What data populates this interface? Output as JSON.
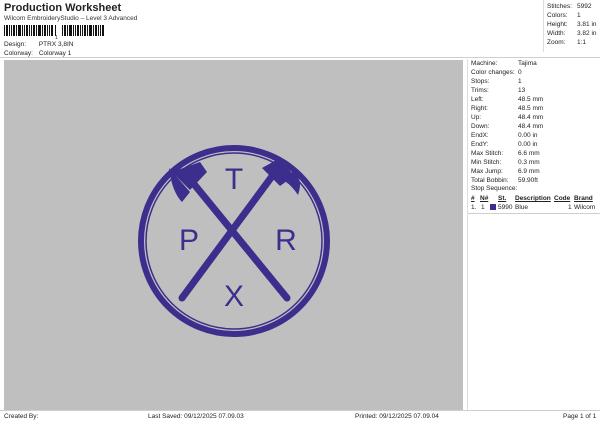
{
  "header": {
    "title": "Production Worksheet",
    "subtitle": "Wilcom EmbroideryStudio – Level 3 Advanced",
    "barcode_number": "1"
  },
  "design_info": {
    "design_label": "Design:",
    "design_value": "PTRX 3,8IN",
    "colorway_label": "Colorway:",
    "colorway_value": "Colorway 1"
  },
  "stats": {
    "stitches_label": "Stitches:",
    "stitches_value": "5992",
    "colors_label": "Colors:",
    "colors_value": "1",
    "height_label": "Height:",
    "height_value": "3.81 in",
    "width_label": "Width:",
    "width_value": "3.82 in",
    "zoom_label": "Zoom:",
    "zoom_value": "1:1"
  },
  "design": {
    "thread_color": "#3b2e8c",
    "letters": {
      "top": "T",
      "left": "P",
      "right": "R",
      "bottom": "X"
    }
  },
  "machine_info": {
    "machine_label": "Machine:",
    "machine_value": "Tajima",
    "color_changes_label": "Color changes:",
    "color_changes_value": "0",
    "stops_label": "Stops:",
    "stops_value": "1",
    "trims_label": "Trims:",
    "trims_value": "13",
    "left_label": "Left:",
    "left_value": "48.5 mm",
    "right_label": "Right:",
    "right_value": "48.5 mm",
    "up_label": "Up:",
    "up_value": "48.4 mm",
    "down_label": "Down:",
    "down_value": "48.4 mm",
    "endx_label": "EndX:",
    "endx_value": "0.00 in",
    "endy_label": "EndY:",
    "endy_value": "0.00 in",
    "max_stitch_label": "Max Stitch:",
    "max_stitch_value": "6.6 mm",
    "min_stitch_label": "Min Stitch:",
    "min_stitch_value": "0.3 mm",
    "max_jump_label": "Max Jump:",
    "max_jump_value": "6.9 mm",
    "total_bobbin_label": "Total Bobbin:",
    "total_bobbin_value": "59.90ft"
  },
  "stop_sequence": {
    "title": "Stop Sequence:",
    "headers": {
      "col1": "#",
      "col2": "N#",
      "col3": "St.",
      "col4": "Description",
      "col5": "Code",
      "col6": "Brand"
    },
    "row": {
      "index": "1.",
      "n": "1",
      "stitches": "5990",
      "description": "Blue",
      "code": "1",
      "brand": "Wilcom"
    }
  },
  "footer": {
    "created_by": "Created By:",
    "last_saved": "Last Saved: 09/12/2025 07.09.03",
    "printed": "Printed: 09/12/2025 07.09.04",
    "page": "Page 1 of 1"
  }
}
